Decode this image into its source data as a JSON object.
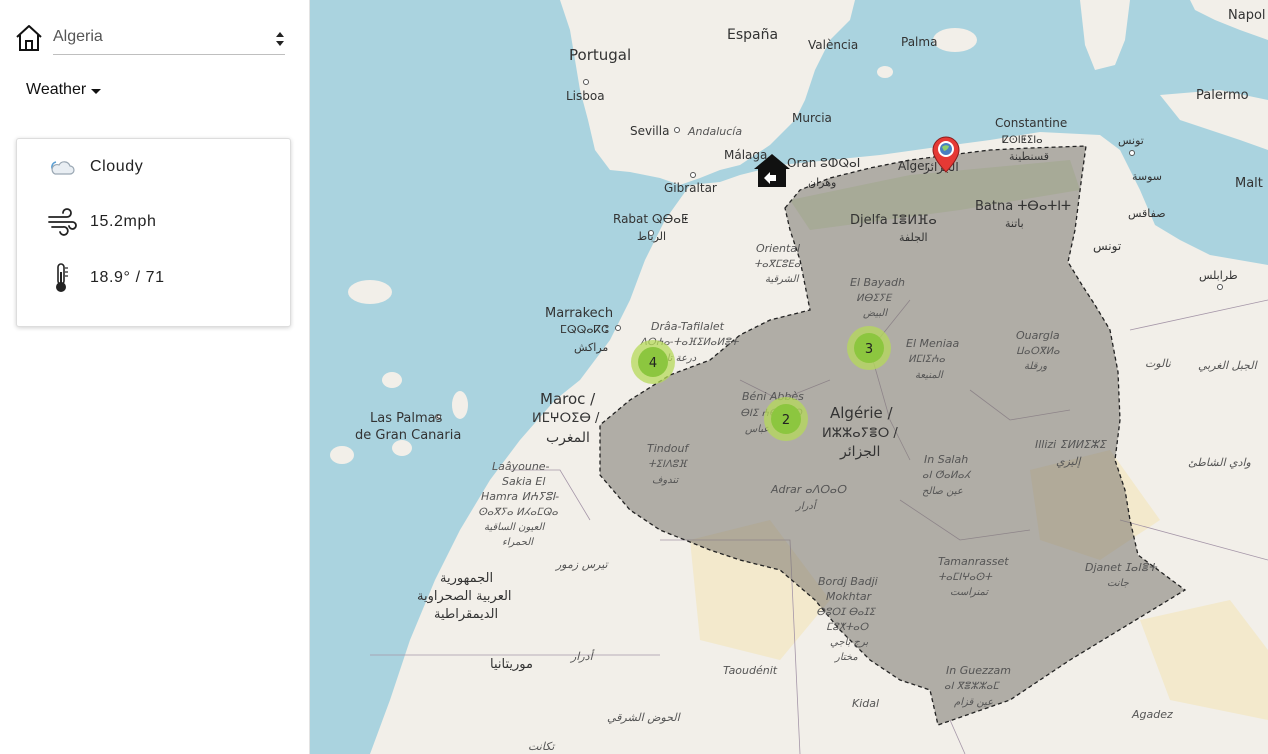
{
  "sidebar": {
    "country_select": {
      "value": "Algeria"
    },
    "weather_toggle": {
      "label": "Weather"
    },
    "weather": {
      "condition": "Cloudy",
      "condition_icon": "cloud-icon",
      "wind": "15.2mph",
      "wind_icon": "wind-icon",
      "temperature": "18.9° / 71",
      "temperature_icon": "thermometer-icon"
    }
  },
  "map": {
    "clusters": [
      {
        "count": "4"
      },
      {
        "count": "3"
      },
      {
        "count": "2"
      }
    ],
    "labels": {
      "napoli": "Napol",
      "espana": "España",
      "valencia": "València",
      "palma": "Palma",
      "portugal": "Portugal",
      "lisboa": "Lisboa",
      "sevilla": "Sevilla",
      "andalucia": "Andalucía",
      "murcia": "Murcia",
      "malaga": "Málaga",
      "gibraltar": "Gibraltar",
      "oran": "Oran ⵓⵀⵕⴰⵏ",
      "oran_ar": "وهران",
      "alger": "Alger",
      "alger_ar": "الجزائر",
      "constantine": "Constantine",
      "constantine_tz": "ⵇⵙⵏⵟⵉⵏⴰ",
      "constantine_ar": "قسنطينة",
      "tunis_ar": "تونس",
      "tunis2_ar": "تونس",
      "sousse_ar": "سوسة",
      "sfax_ar": "صفاقس",
      "tarabulus_ar": "طرابلس",
      "palermo": "Palermo",
      "malta": "Malt",
      "rabat": "Rabat ⵕⴱⴰⵟ",
      "rabat_ar": "الرباط",
      "djelfa": "Djelfa ⵊⴻⵍⴼⴰ",
      "djelfa_ar": "الجلفة",
      "batna": "Batna ⵜⴱⴰⵜⵏⵜ",
      "batna_ar": "باتنة",
      "oriental": "Oriental",
      "oriental_tz": "ⵜⴰⴳⵎⵓⴹⴰ",
      "oriental_ar": "الشرقية",
      "el_bayadh": "El Bayadh",
      "el_bayadh_tz": "ⵍⴱⵉⵢⴹ",
      "el_bayadh_ar": "البيض",
      "marrakech": "Marrakech",
      "marrakech_tz": "ⵎⵕⵕⴰⴽⵛ",
      "marrakech_ar": "مراكش",
      "draa": "Drâa-Tafilalet",
      "draa_tz": "ⴷⵔⵄⴰ-ⵜⴰⴼⵉⵍⴰⵍⴻⵜ",
      "draa_ar": "درعة تافيلالت",
      "el_meniaa": "El Meniaa",
      "el_meniaa_tz": "ⵍⵎⵏⵉⵄⴰ",
      "el_meniaa_ar": "المنيعة",
      "ouargla": "Ouargla",
      "ouargla_tz": "ⵡⴰⵔⴳⵍⴰ",
      "ouargla_ar": "ورقلة",
      "nalut_ar": "نالوت",
      "jabal_ar": "الجبل الغربي",
      "beni_abbes": "Béni Abbès",
      "beni_abbes_tz": "ⴱⵏⵉ ⵄⴱⴱⴰⵙ",
      "beni_abbes_ar": "عباس",
      "maroc": "Maroc /",
      "maroc_tz": "ⵍⵎⵖⵔⵉⴱ /",
      "maroc_ar": "المغرب",
      "algerie": "Algérie /",
      "algerie_tz": "ⵍⵣⵣⴰⵢⴻⵔ /",
      "algerie_ar": "الجزائر",
      "las_palmas": "Las Palmas",
      "gran_canaria": "de Gran Canaria",
      "illizi": "Illizi ⵉⵍⵍⵉⵣⵉ",
      "illizi_ar": "إليزي",
      "wadi_ar": "وادي الشاطئ",
      "laayoune": "Laâyoune-",
      "sakia": "Sakia El",
      "hamra": "Hamra ⵍⵄⵢⵓⵏ-",
      "hamra_tz": "ⵙⴰⴳⵢⴰ ⵍⵃⴰⵎⵕⴰ",
      "hamra_ar": "العيون الساقية",
      "hamra_ar2": "الحمراء",
      "tindouf": "Tindouf",
      "tindouf_tz": "ⵜⵉⵏⴷⵓⴼ",
      "tindouf_ar": "تندوف",
      "in_salah": "In Salah",
      "in_salah_tz": "ⴰⵏ ⵚⴰⵍⴰⵃ",
      "in_salah_ar": "عين صالح",
      "adrar": "Adrar ⴰⴷⵔⴰⵔ",
      "adrar_ar": "أدرار",
      "tiris_ar": "تيرس زمور",
      "sahrawi_ar1": "الجمهورية",
      "sahrawi_ar2": "العربية الصحراوية",
      "sahrawi_ar3": "الديمقراطية",
      "tamanrasset": "Tamanrasset",
      "tamanrasset_tz": "ⵜⴰⵎⵏⵖⴰⵙⵜ",
      "tamanrasset_ar": "تمنراست",
      "djanet": "Djanet ⵊⴰⵏⴻⵜ",
      "djanet_ar": "جانت",
      "bordj": "Bordj Badji",
      "mokhtar": "Mokhtar",
      "bordj_tz": "ⴱⵓⵔⵊ ⴱⴰⵊⵉ",
      "bordj_tz2": "ⵎⵓⵅⵜⴰⵔ",
      "bordj_ar": "برج باجي",
      "bordj_ar2": "مختار",
      "mauritania_ar": "موريتانيا",
      "adrar2_ar": "أدرار",
      "taoudenit": "Taoudénit",
      "kidal": "Kidal",
      "in_guezzam": "In Guezzam",
      "in_guezzam_tz": "ⴰⵏ ⴳⴻⵣⵣⴰⵎ",
      "in_guezzam_ar": "عين قزام",
      "agadez": "Agadez",
      "hodh_ar": "الحوض الشرقي",
      "tagant_ar": "تكانت"
    }
  },
  "colors": {
    "sea": "#aad3df",
    "land": "#f2efe9",
    "country_fill": "#777777",
    "cluster_inner": "#8cc63f",
    "cluster_outer": "#b5d95a",
    "pin_red": "#e53935"
  }
}
